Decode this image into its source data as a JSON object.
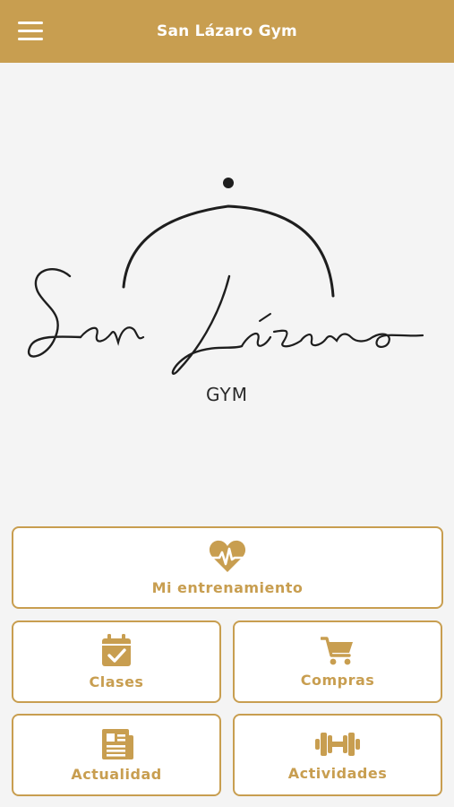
{
  "app": {
    "title": "San Lázaro Gym"
  },
  "logo": {
    "script_text": "San Lázaro",
    "sub_text": "GYM"
  },
  "tiles": {
    "training": {
      "label": "Mi entrenamiento",
      "icon": "heartbeat-icon"
    },
    "clases": {
      "label": "Clases",
      "icon": "calendar-check-icon"
    },
    "compras": {
      "label": "Compras",
      "icon": "shopping-cart-icon"
    },
    "actualidad": {
      "label": "Actualidad",
      "icon": "newspaper-icon"
    },
    "actividades": {
      "label": "Actividades",
      "icon": "dumbbell-icon"
    }
  },
  "colors": {
    "brand": "#c89e50",
    "background": "#f4f4f4",
    "tile_background": "#ffffff"
  }
}
